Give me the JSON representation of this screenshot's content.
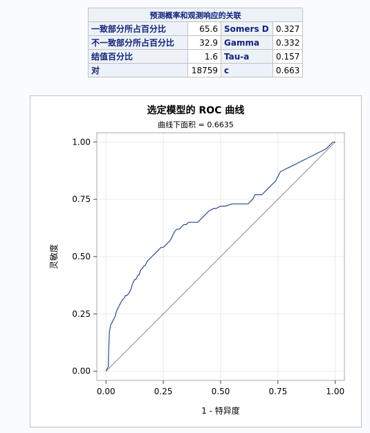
{
  "association_table": {
    "title": "预测概率和观测响应的关联",
    "rows": [
      {
        "label": "一致部分所占百分比",
        "value": "65.6",
        "stat_name": "Somers D",
        "stat_value": "0.327"
      },
      {
        "label": "不一致部分所占百分比",
        "value": "32.9",
        "stat_name": "Gamma",
        "stat_value": "0.332"
      },
      {
        "label": "结值百分比",
        "value": "1.6",
        "stat_name": "Tau-a",
        "stat_value": "0.157"
      },
      {
        "label": "对",
        "value": "18759",
        "stat_name": "c",
        "stat_value": "0.663"
      }
    ]
  },
  "chart_data": {
    "type": "line",
    "title": "选定模型的 ROC 曲线",
    "subtitle": "曲线下面积 = 0.6635",
    "xlabel": "1 - 特异度",
    "ylabel": "灵敏度",
    "xlim": [
      -0.04,
      1.04
    ],
    "ylim": [
      -0.04,
      1.04
    ],
    "x_ticks": [
      "0.00",
      "0.25",
      "0.50",
      "0.75",
      "1.00"
    ],
    "y_ticks": [
      "0.00",
      "0.25",
      "0.50",
      "0.75",
      "1.00"
    ],
    "grid": true,
    "series": [
      {
        "color": "#2a4a8a",
        "x": [
          0.0,
          0.005,
          0.01,
          0.012,
          0.015,
          0.02,
          0.03,
          0.035,
          0.04,
          0.045,
          0.05,
          0.055,
          0.06,
          0.065,
          0.07,
          0.08,
          0.085,
          0.09,
          0.1,
          0.105,
          0.11,
          0.115,
          0.12,
          0.125,
          0.13,
          0.135,
          0.14,
          0.145,
          0.15,
          0.16,
          0.165,
          0.17,
          0.175,
          0.18,
          0.19,
          0.2,
          0.21,
          0.22,
          0.23,
          0.24,
          0.25,
          0.26,
          0.27,
          0.28,
          0.29,
          0.3,
          0.31,
          0.32,
          0.33,
          0.34,
          0.35,
          0.36,
          0.37,
          0.38,
          0.39,
          0.4,
          0.41,
          0.42,
          0.43,
          0.45,
          0.47,
          0.48,
          0.5,
          0.52,
          0.55,
          0.58,
          0.6,
          0.62,
          0.64,
          0.65,
          0.66,
          0.68,
          0.7,
          0.72,
          0.74,
          0.75,
          0.76,
          0.78,
          0.8,
          0.82,
          0.84,
          0.86,
          0.88,
          0.9,
          0.92,
          0.94,
          0.96,
          0.97,
          0.98,
          0.99,
          1.0
        ],
        "y": [
          0.0,
          0.01,
          0.02,
          0.1,
          0.17,
          0.2,
          0.22,
          0.23,
          0.24,
          0.26,
          0.27,
          0.28,
          0.29,
          0.3,
          0.31,
          0.32,
          0.33,
          0.33,
          0.34,
          0.35,
          0.36,
          0.38,
          0.39,
          0.4,
          0.4,
          0.41,
          0.42,
          0.42,
          0.44,
          0.45,
          0.46,
          0.46,
          0.47,
          0.48,
          0.49,
          0.5,
          0.51,
          0.52,
          0.53,
          0.54,
          0.54,
          0.55,
          0.56,
          0.57,
          0.59,
          0.61,
          0.62,
          0.62,
          0.63,
          0.64,
          0.64,
          0.65,
          0.65,
          0.65,
          0.65,
          0.65,
          0.66,
          0.67,
          0.68,
          0.7,
          0.71,
          0.71,
          0.72,
          0.72,
          0.73,
          0.73,
          0.73,
          0.73,
          0.75,
          0.77,
          0.77,
          0.77,
          0.79,
          0.81,
          0.83,
          0.85,
          0.87,
          0.88,
          0.89,
          0.9,
          0.91,
          0.92,
          0.93,
          0.94,
          0.95,
          0.96,
          0.97,
          0.98,
          0.99,
          1.0,
          1.0
        ]
      }
    ],
    "reference_line": {
      "x": [
        0,
        1
      ],
      "y": [
        0,
        1
      ],
      "color": "#888888"
    }
  }
}
